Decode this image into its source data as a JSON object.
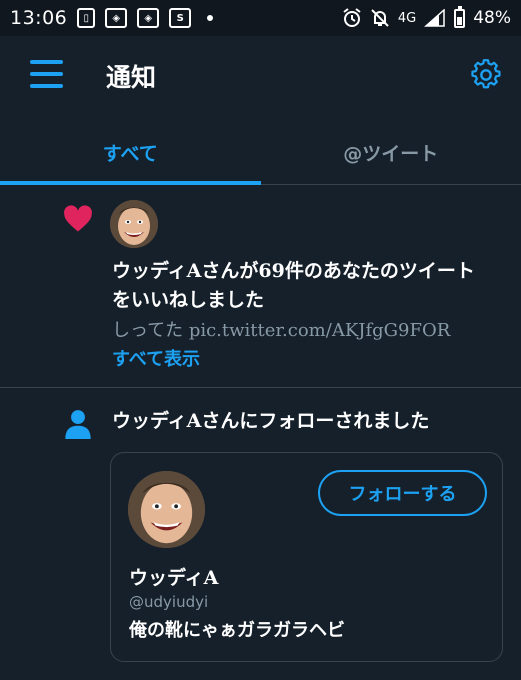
{
  "status_bar": {
    "time": "13:06",
    "network": "4G",
    "battery": "48%",
    "battery_level": 0.48
  },
  "header": {
    "title": "通知",
    "menu_icon": "hamburger-menu-icon",
    "settings_icon": "gear-icon"
  },
  "tabs": [
    {
      "label": "すべて",
      "active": true
    },
    {
      "label": "@ツイート",
      "active": false
    }
  ],
  "notifications": {
    "like": {
      "icon": "heart-icon",
      "text": "ウッディAさんが69件のあなたのツイートをいいねしました",
      "preview": "しってた pic.twitter.com/AKJfgG9FOR",
      "show_all": "すべて表示"
    },
    "follow": {
      "icon": "person-icon",
      "text": "ウッディAさんにフォローされました",
      "card": {
        "name": "ウッディA",
        "handle": "@udyiudyi",
        "bio": "俺の靴にゃぁガラガラヘビ",
        "follow_button": "フォローする"
      }
    }
  },
  "colors": {
    "background": "#15202b",
    "accent": "#1da1f2",
    "like": "#e0245e",
    "muted": "#8899a6",
    "border": "#38444d"
  }
}
